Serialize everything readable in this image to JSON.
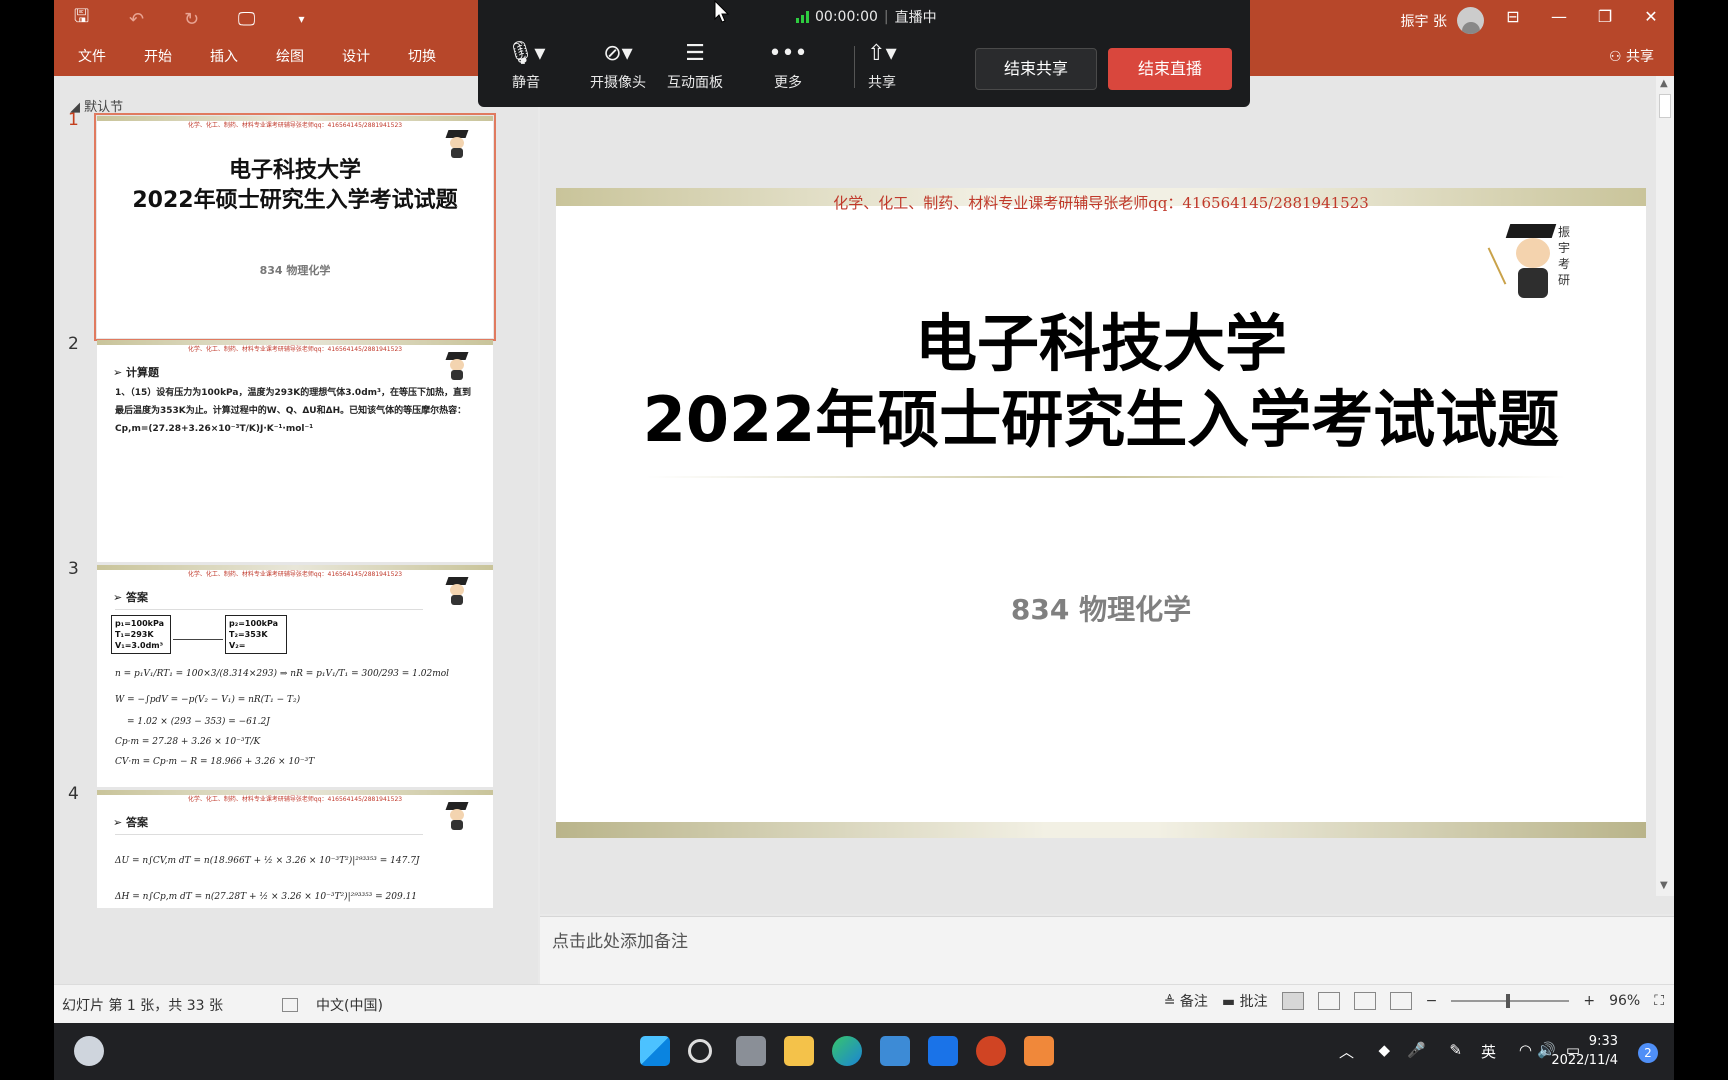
{
  "ribbon": {
    "qat": {
      "save": "🖫",
      "undo": "↶",
      "redo": "↻",
      "present": "🖵",
      "more": "▾"
    },
    "menu": [
      "文件",
      "开始",
      "插入",
      "绘图",
      "设计",
      "切换"
    ],
    "user_name": "振宇 张",
    "share_label": "共享"
  },
  "meeting": {
    "timer": "00:00:00",
    "live_status": "直播中",
    "buttons": [
      {
        "label": "静音",
        "icon": "microphone-icon"
      },
      {
        "label": "开摄像头",
        "icon": "camera-off-icon"
      },
      {
        "label": "互动面板",
        "icon": "chat-icon"
      },
      {
        "label": "更多",
        "icon": "more-icon"
      },
      {
        "label": "共享",
        "icon": "screen-share-icon"
      }
    ],
    "end_share": "结束共享",
    "end_live": "结束直播"
  },
  "slides_panel": {
    "section": "默认节",
    "header_text": "化学、化工、制药、材料专业课考研辅导张老师qq：416564145/2881941523",
    "thumbs": [
      {
        "num": "1",
        "title1": "电子科技大学",
        "title2": "2022年硕士研究生入学考试试题",
        "sub": "834 物理化学"
      },
      {
        "num": "2",
        "heading": "计算题",
        "text": "1、（15）设有压力为100kPa，温度为293K的理想气体3.0dm³，在等压下加热，直到最后温度为353K为止。计算过程中的W、Q、ΔU和ΔH。已知该气体的等压摩尔热容：Cp,m=(27.28+3.26×10⁻³T/K)J·K⁻¹·mol⁻¹"
      },
      {
        "num": "3",
        "heading": "答案",
        "box1": [
          "p₁=100kPa",
          "T₁=293K",
          "V₁=3.0dm³"
        ],
        "box2": [
          "p₂=100kPa",
          "T₂=353K",
          "V₂="
        ],
        "eqs": [
          "n = p₁V₁/RT₁ = 100×3/(8.314×293) ⇒ nR = p₁V₁/T₁ = 300/293 = 1.02mol",
          "W = −∫pdV = −p(V₂ − V₁) = nR(T₁ − T₂)",
          "= 1.02 × (293 − 353) = −61.2J",
          "Cp·m = 27.28 + 3.26 × 10⁻³T/K",
          "CV·m = Cp·m − R = 18.966 + 3.26 × 10⁻³T"
        ]
      },
      {
        "num": "4",
        "heading": "答案",
        "eqs": [
          "ΔU = n∫CV,m dT = n(18.966T + ½ × 3.26 × 10⁻³T²)|²⁹³³⁵³ = 147.7J",
          "ΔH = n∫Cp,m dT = n(27.28T + ½ × 3.26 × 10⁻³T²)|²⁹³³⁵³ = 209.11"
        ]
      }
    ]
  },
  "slide": {
    "header": "化学、化工、制药、材料专业课考研辅导张老师qq：416564145/2881941523",
    "title1": "电子科技大学",
    "title2": "2022年硕士研究生入学考试试题",
    "subtitle": "834 物理化学",
    "logo_tag": "振宇考研"
  },
  "notes_placeholder": "点击此处添加备注",
  "status": {
    "slide_info": "幻灯片 第 1 张，共 33 张",
    "language": "中文(中国)",
    "notes": "备注",
    "comments": "批注",
    "zoom": "96%"
  },
  "taskbar": {
    "ime": "英",
    "time": "9:33",
    "date": "2022/11/4",
    "notifications": "2"
  },
  "colors": {
    "ribbon": "#b7472a",
    "end_live": "#d9473d",
    "meeting_bg": "#1b1c1e"
  }
}
